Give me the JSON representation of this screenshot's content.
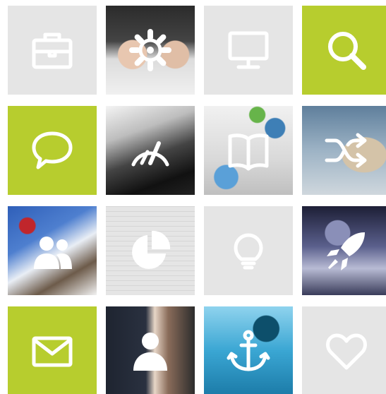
{
  "tiles": [
    {
      "id": "t0",
      "style": "gray",
      "photo": "",
      "icon": "briefcase-icon"
    },
    {
      "id": "t1",
      "style": "photo",
      "photo": "hands",
      "icon": "gear-icon"
    },
    {
      "id": "t2",
      "style": "gray",
      "photo": "",
      "icon": "monitor-icon"
    },
    {
      "id": "t3",
      "style": "green",
      "photo": "",
      "icon": "search-icon"
    },
    {
      "id": "t4",
      "style": "green",
      "photo": "",
      "icon": "chat-bubble-icon"
    },
    {
      "id": "t5",
      "style": "photo",
      "photo": "car",
      "icon": "speedometer-icon"
    },
    {
      "id": "t6",
      "style": "photo",
      "photo": "cubes",
      "icon": "open-book-icon"
    },
    {
      "id": "t7",
      "style": "photo",
      "photo": "jump",
      "icon": "shuffle-icon"
    },
    {
      "id": "t8",
      "style": "photo",
      "photo": "climb",
      "icon": "users-icon"
    },
    {
      "id": "t9",
      "style": "photo",
      "photo": "math",
      "icon": "pie-chart-icon"
    },
    {
      "id": "t10",
      "style": "gray",
      "photo": "",
      "icon": "lightbulb-icon"
    },
    {
      "id": "t11",
      "style": "photo",
      "photo": "moto",
      "icon": "rocket-icon"
    },
    {
      "id": "t12",
      "style": "green",
      "photo": "",
      "icon": "envelope-icon"
    },
    {
      "id": "t13",
      "style": "photo",
      "photo": "people",
      "icon": "user-icon"
    },
    {
      "id": "t14",
      "style": "photo",
      "photo": "water",
      "icon": "anchor-icon"
    },
    {
      "id": "t15",
      "style": "gray",
      "photo": "",
      "icon": "heart-icon"
    }
  ],
  "colors": {
    "accent_green": "#b7cd2e",
    "tile_gray": "#e5e5e5",
    "icon": "#ffffff"
  }
}
